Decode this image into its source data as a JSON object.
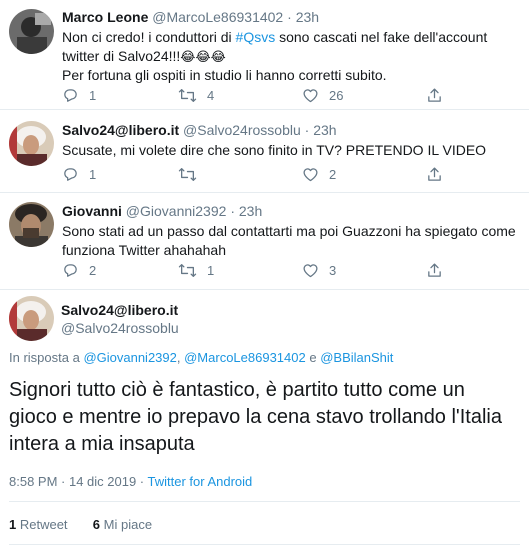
{
  "tweets": [
    {
      "name": "Marco Leone",
      "handle": "@MarcoLe86931402",
      "dot": "·",
      "time": "23h",
      "text_before": "Non ci credo! i conduttori di ",
      "hashtag": "#Qsvs",
      "text_after": " sono cascati nel fake dell'account twitter di Salvo24!!!",
      "emoji": "😂😂😂",
      "text_line2": "Per fortuna gli ospiti in studio li hanno corretti subito.",
      "replies": "1",
      "retweets": "4",
      "likes": "26"
    },
    {
      "name": "Salvo24@libero.it",
      "handle": "@Salvo24rossoblu",
      "dot": "·",
      "time": "23h",
      "text": "Scusate, mi volete dire che sono finito in TV? PRETENDO IL VIDEO",
      "replies": "1",
      "retweets": "",
      "likes": "2"
    },
    {
      "name": "Giovanni",
      "handle": "@Giovanni2392",
      "dot": "·",
      "time": "23h",
      "text": "Sono stati ad un passo dal contattarti ma poi Guazzoni ha spiegato come funziona Twitter ahahahah",
      "replies": "2",
      "retweets": "1",
      "likes": "3"
    }
  ],
  "main_tweet": {
    "name": "Salvo24@libero.it",
    "handle": "@Salvo24rossoblu",
    "reply_prefix": "In risposta a ",
    "reply_user1": "@Giovanni2392",
    "reply_sep1": ", ",
    "reply_user2": "@MarcoLe86931402",
    "reply_sep2": " e ",
    "reply_user3": "@BBilanShit",
    "text": "Signori tutto ciò è fantastico, è partito tutto come un gioco e mentre io prepavo la cena stavo trollando l'Italia intera a mia insaputa",
    "timestamp": "8:58 PM · 14 dic 2019 · ",
    "source": "Twitter for Android",
    "retweet_count": "1",
    "retweet_label": " Retweet",
    "like_count": "6",
    "like_label": " Mi piace"
  },
  "colors": {
    "link": "#1b95e0",
    "secondary": "#657786",
    "border": "#e6ecf0",
    "text": "#14171a"
  },
  "icons": [
    "reply-icon",
    "retweet-icon",
    "like-icon",
    "share-icon"
  ]
}
